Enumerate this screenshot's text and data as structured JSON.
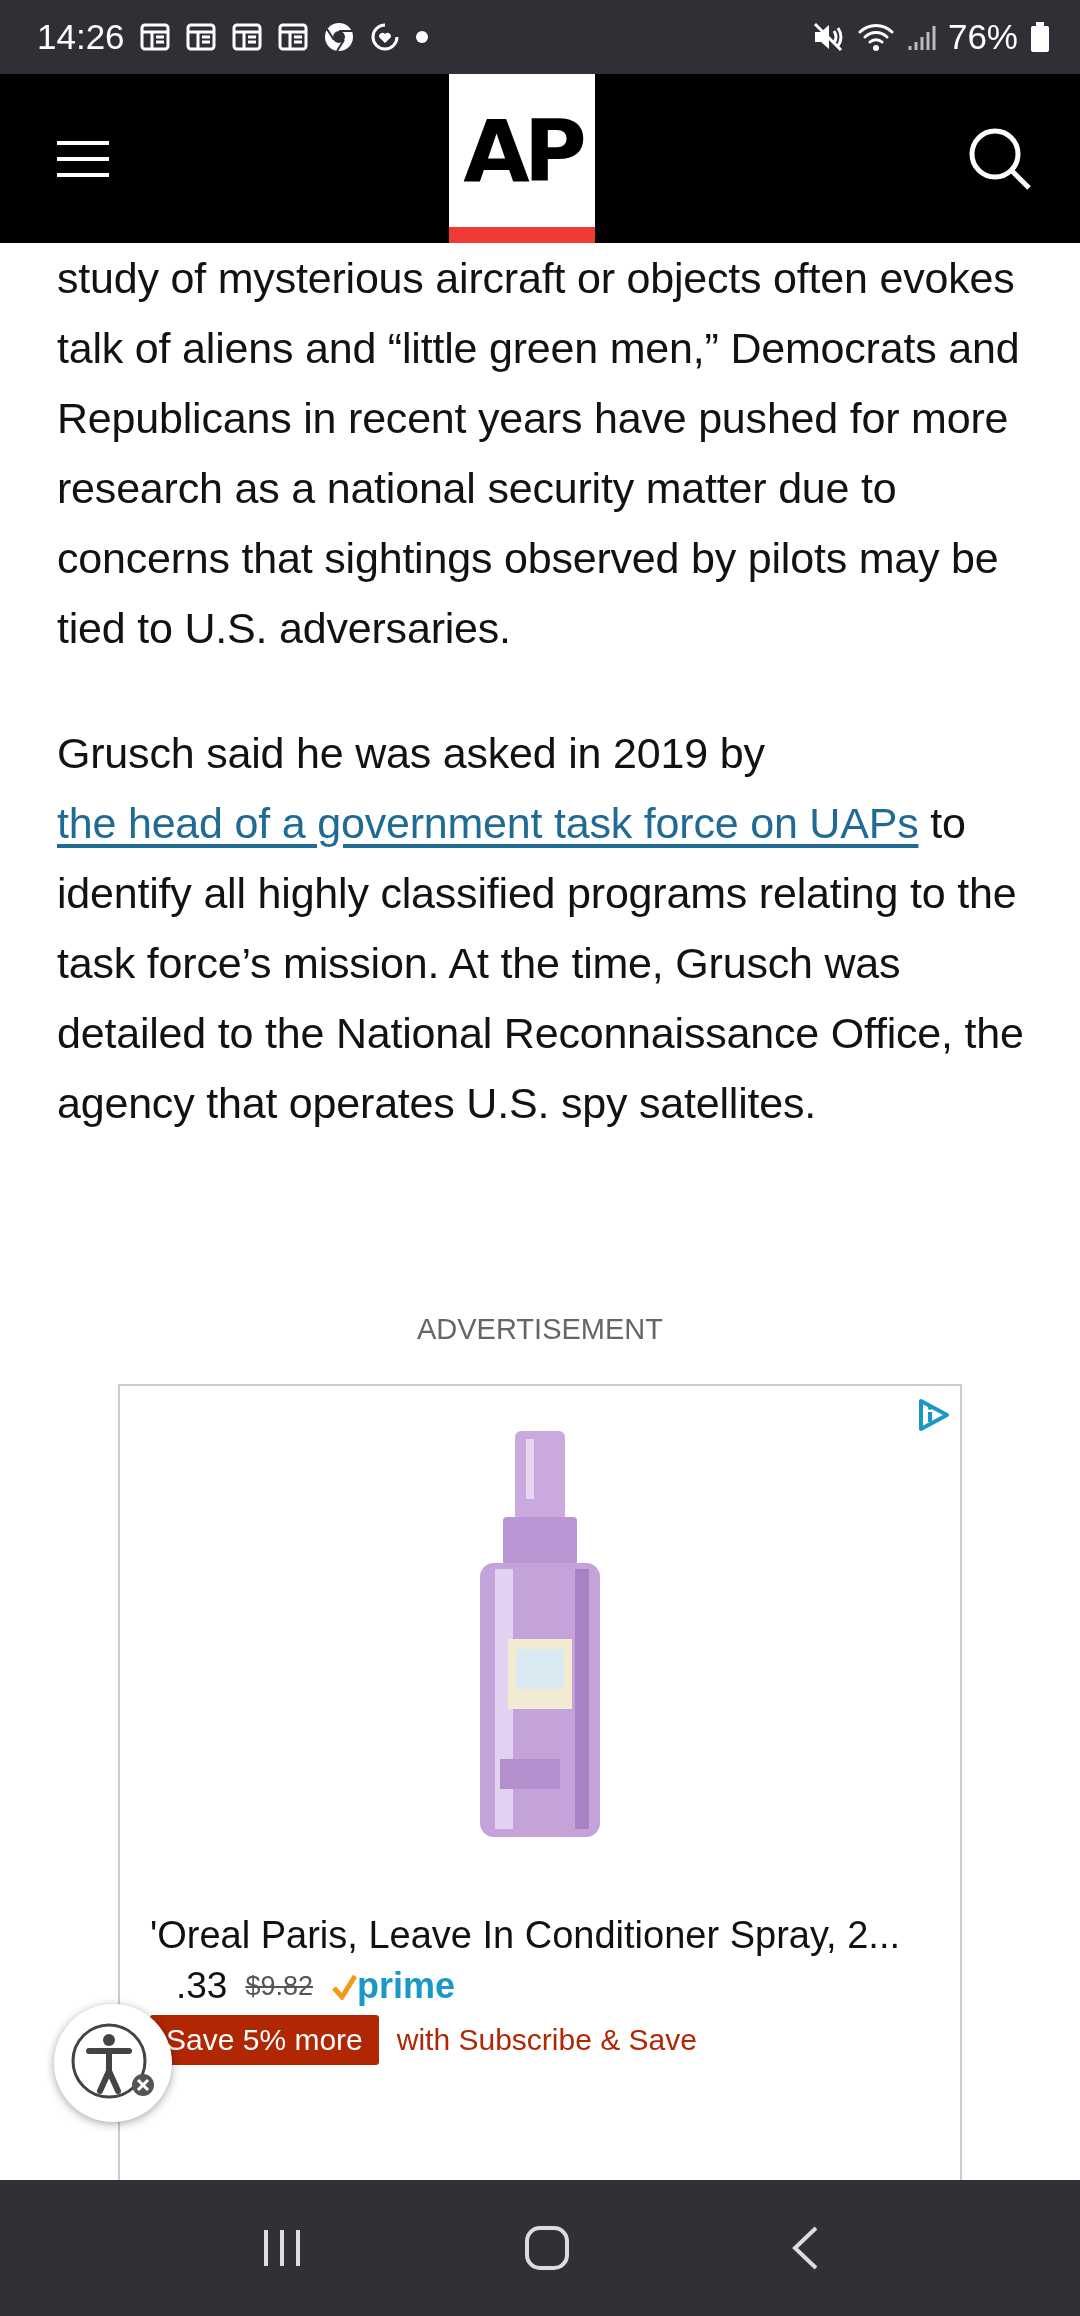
{
  "status_bar": {
    "time": "14:26",
    "battery": "76%"
  },
  "header": {
    "logo": "AP"
  },
  "article": {
    "paragraphs": [
      {
        "segments": [
          {
            "kind": "text",
            "text": "study of mysterious aircraft or objects often evokes talk of aliens and “little green men,” Democrats and Republicans in recent years have pushed for more research as a national security matter due to concerns that sightings observed by pilots may be tied to U.S. adversaries."
          }
        ]
      },
      {
        "segments": [
          {
            "kind": "text",
            "text": "Grusch said he was asked in 2019 by "
          },
          {
            "kind": "link",
            "text": "the head of a government task force on UAPs"
          },
          {
            "kind": "text",
            "text": " to identify all highly classified programs relating to the task force’s mission. At the time, Grusch was detailed to the National Reconnaissance Office, the agency that operates U.S. spy satellites."
          }
        ]
      }
    ]
  },
  "advertisement": {
    "label": "ADVERTISEMENT",
    "title": "'Oreal Paris, Leave In Conditioner Spray, 2...",
    "price": ".33",
    "list_price": "$9.82",
    "prime": "prime",
    "save_badge": "Save 5% more",
    "save_note": "with Subscribe & Save"
  }
}
